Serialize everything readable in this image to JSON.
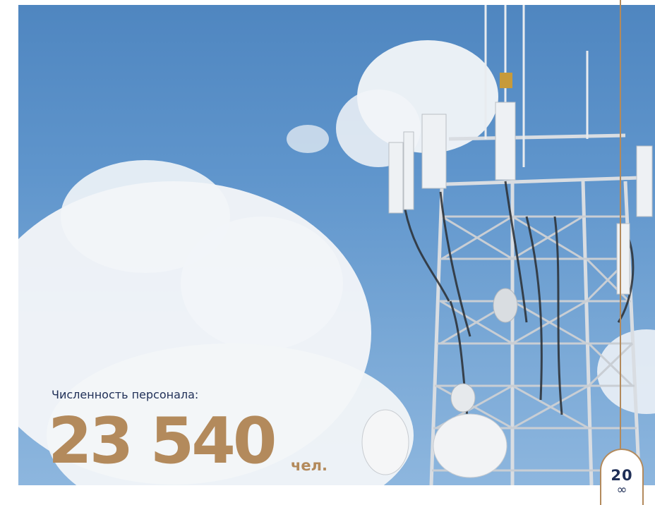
{
  "stats": {
    "label": "Численность персонала:",
    "value": "23 540",
    "unit": "чел."
  },
  "page": {
    "number": "20",
    "suffix": "∞"
  },
  "colors": {
    "accent": "#b38a5c",
    "text_dark": "#1f2f57",
    "sky": "#5f95cc"
  }
}
